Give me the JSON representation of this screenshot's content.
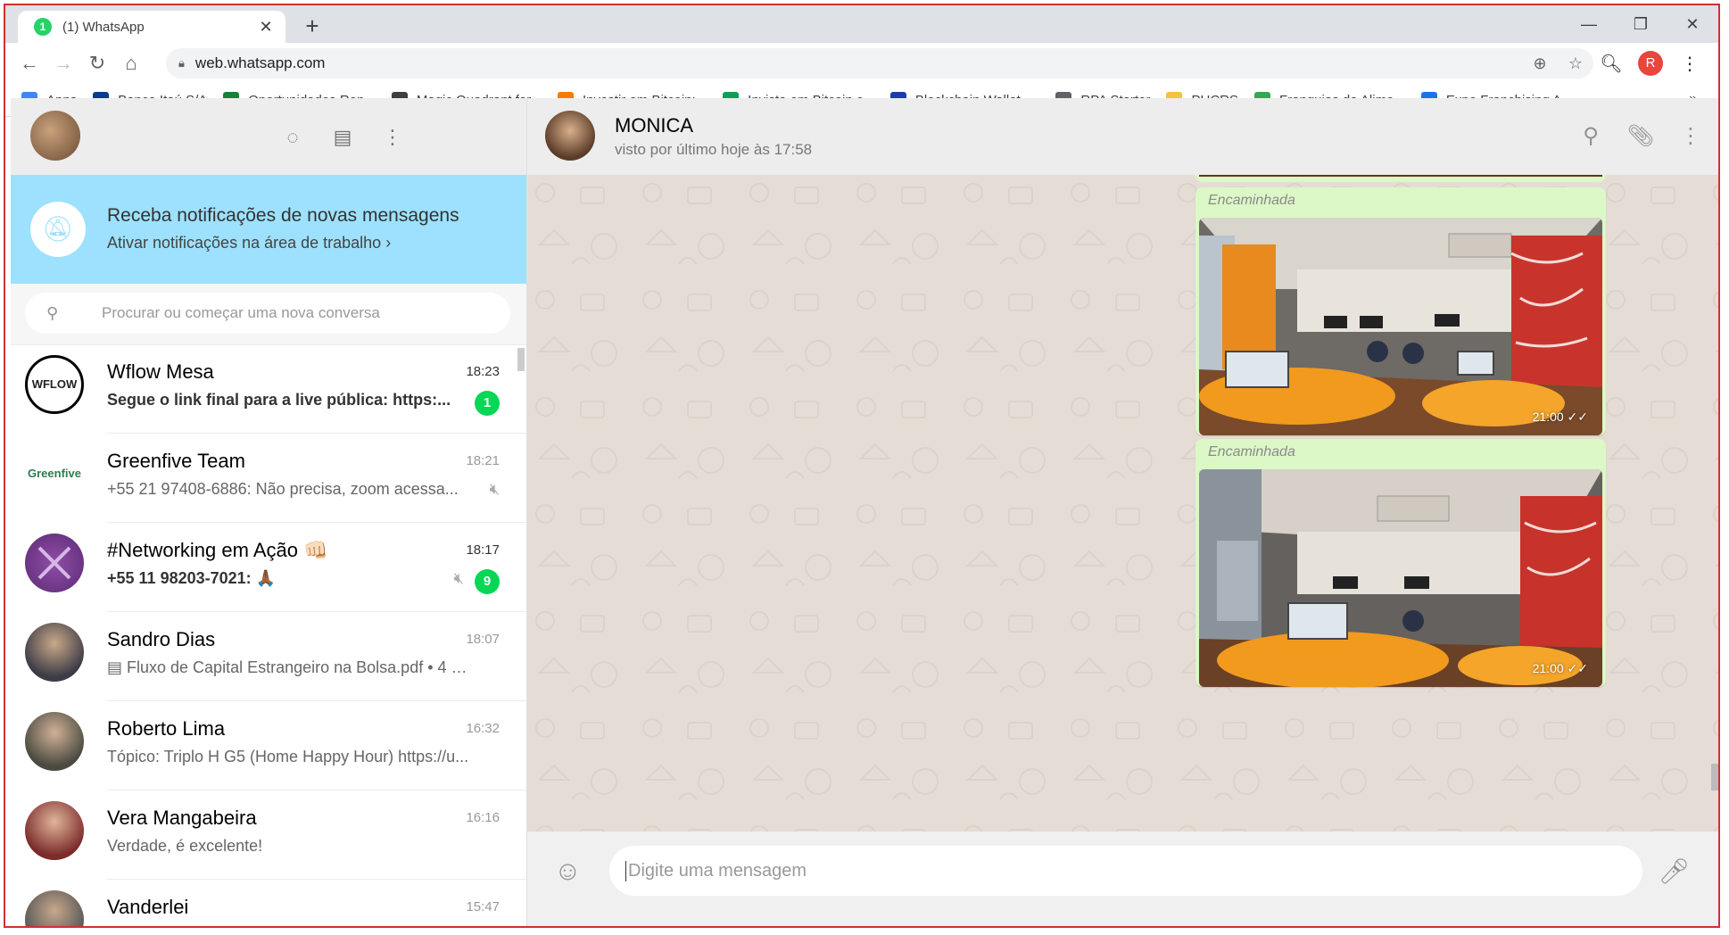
{
  "browser": {
    "tab_title": "(1) WhatsApp",
    "tab_badge": "1",
    "url": "web.whatsapp.com",
    "profile_initial": "R",
    "bookmarks": [
      {
        "label": "Apps",
        "color": "#4285f4"
      },
      {
        "label": "Banco Itaú S/A",
        "color": "#0b3b8c"
      },
      {
        "label": "Oportunidades Ron...",
        "color": "#188038"
      },
      {
        "label": "Magic Quadrant for...",
        "color": "#3c4043"
      },
      {
        "label": "Investir em Bitcoin:...",
        "color": "#f57c00"
      },
      {
        "label": "Invista em Bitcoin c...",
        "color": "#0f9d58"
      },
      {
        "label": "Blockchain Wallet -...",
        "color": "#1a3ea8"
      },
      {
        "label": "RPA Starter",
        "color": "#5f6368"
      },
      {
        "label": "PUCRS",
        "color": "#f6c23e"
      },
      {
        "label": "Franquias de Alime...",
        "color": "#34a853"
      },
      {
        "label": "Expo Franchising A...",
        "color": "#1a73e8"
      }
    ],
    "bookmarks_more": "»"
  },
  "notification": {
    "title": "Receba notificações de novas mensagens",
    "subtitle": "Ativar notificações na área de trabalho ›"
  },
  "search": {
    "placeholder": "Procurar ou começar uma nova conversa"
  },
  "chats": [
    {
      "name": "Wflow Mesa",
      "time": "18:23",
      "message": "Segue o link final para a live pública: https:...",
      "unread": "1",
      "bold": true
    },
    {
      "name": "Greenfive Team",
      "time": "18:21",
      "message": "+55 21 97408-6886: Não precisa, zoom acessa...",
      "muted": true
    },
    {
      "name": "#Networking em Ação 👊🏻",
      "time": "18:17",
      "message": "+55 11 98203-7021: 🙏🏾",
      "unread": "9",
      "muted": true,
      "bold": true
    },
    {
      "name": "Sandro Dias",
      "time": "18:07",
      "message": "▤ Fluxo de Capital Estrangeiro na Bolsa.pdf • 4 p..."
    },
    {
      "name": "Roberto Lima",
      "time": "16:32",
      "message": "Tópico: Triplo H G5 (Home Happy Hour) https://u..."
    },
    {
      "name": "Vera Mangabeira",
      "time": "16:16",
      "message": "Verdade, é excelente!"
    },
    {
      "name": "Vanderlei",
      "time": "15:47",
      "message": ""
    }
  ],
  "contact": {
    "name": "MONICA",
    "status": "visto por último hoje às 17:58"
  },
  "messages": [
    {
      "forwarded": "Encaminhada",
      "time": "21:00 ✓✓"
    },
    {
      "forwarded": "Encaminhada",
      "time": "21:00 ✓✓"
    }
  ],
  "composer": {
    "placeholder": "Digite uma mensagem"
  },
  "colors": {
    "whatsapp_green": "#25d366",
    "notification_bg": "#9de1fe",
    "bubble_out": "#dcf8c6",
    "chat_bg": "#e5ddd5",
    "unread_badge": "#06d755"
  }
}
